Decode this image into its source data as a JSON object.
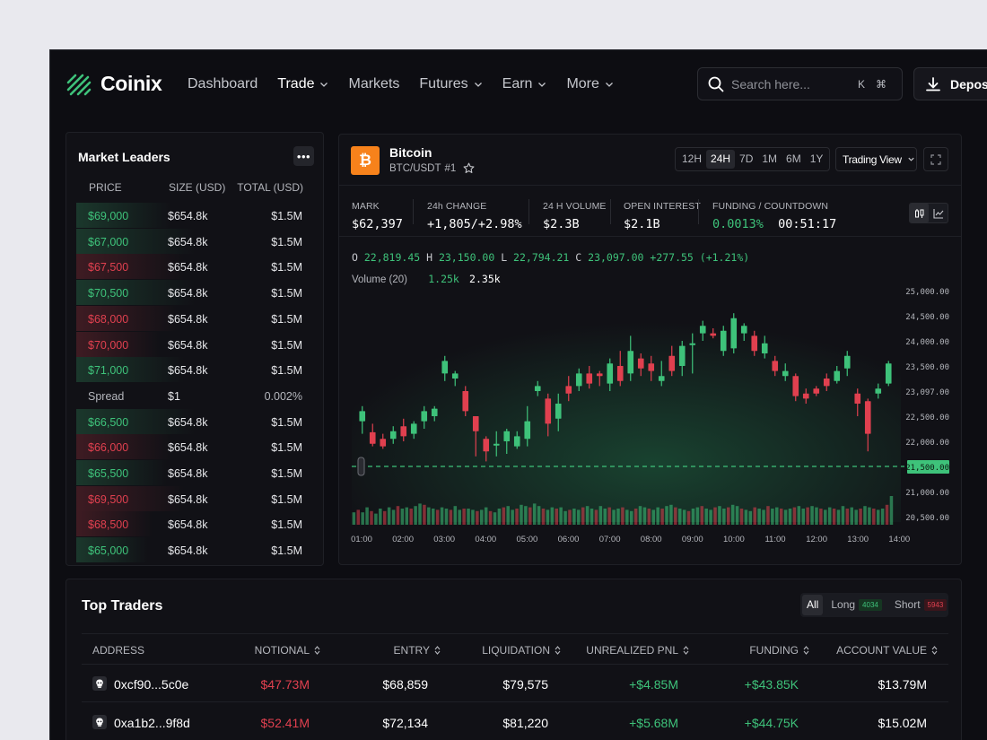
{
  "brand": {
    "name": "Coinix",
    "color": "#3ec27a"
  },
  "nav": [
    {
      "label": "Dashboard",
      "dropdown": false,
      "active": false
    },
    {
      "label": "Trade",
      "dropdown": true,
      "active": true
    },
    {
      "label": "Markets",
      "dropdown": false,
      "active": false
    },
    {
      "label": "Futures",
      "dropdown": true,
      "active": false
    },
    {
      "label": "Earn",
      "dropdown": true,
      "active": false
    },
    {
      "label": "More",
      "dropdown": true,
      "active": false
    }
  ],
  "search": {
    "placeholder": "Search here...",
    "shortcut_1": "K",
    "shortcut_2": "⌘"
  },
  "deposit_label": "Deposit",
  "leaders": {
    "title": "Market Leaders",
    "columns": [
      "PRICE",
      "SIZE (USD)",
      "TOTAL (USD)"
    ],
    "rows": [
      {
        "price": "$69,000",
        "size": "$654.8k",
        "total": "$1.5M",
        "side": "buy",
        "depth": 0.4
      },
      {
        "price": "$67,000",
        "size": "$654.8k",
        "total": "$1.5M",
        "side": "buy",
        "depth": 0.5
      },
      {
        "price": "$67,500",
        "size": "$654.8k",
        "total": "$1.5M",
        "side": "sell",
        "depth": 0.45
      },
      {
        "price": "$70,500",
        "size": "$654.8k",
        "total": "$1.5M",
        "side": "buy",
        "depth": 0.5
      },
      {
        "price": "$68,000",
        "size": "$654.8k",
        "total": "$1.5M",
        "side": "sell",
        "depth": 0.42
      },
      {
        "price": "$70,000",
        "size": "$654.8k",
        "total": "$1.5M",
        "side": "sell",
        "depth": 0.35
      },
      {
        "price": "$71,000",
        "size": "$654.8k",
        "total": "$1.5M",
        "side": "buy",
        "depth": 0.45
      },
      {
        "price": "Spread",
        "size": "$1",
        "total": "0.002%",
        "side": "spread",
        "depth": 0
      },
      {
        "price": "$66,500",
        "size": "$654.8k",
        "total": "$1.5M",
        "side": "buy",
        "depth": 0.5
      },
      {
        "price": "$66,000",
        "size": "$654.8k",
        "total": "$1.5M",
        "side": "sell",
        "depth": 0.4
      },
      {
        "price": "$65,500",
        "size": "$654.8k",
        "total": "$1.5M",
        "side": "buy",
        "depth": 0.38
      },
      {
        "price": "$69,500",
        "size": "$654.8k",
        "total": "$1.5M",
        "side": "sell",
        "depth": 0.45
      },
      {
        "price": "$68,500",
        "size": "$654.8k",
        "total": "$1.5M",
        "side": "sell",
        "depth": 0.32
      },
      {
        "price": "$65,000",
        "size": "$654.8k",
        "total": "$1.5M",
        "side": "buy",
        "depth": 0.3
      }
    ]
  },
  "coin": {
    "name": "Bitcoin",
    "pair": "BTC/USDT",
    "rank": "#1",
    "timeframes": [
      "12H",
      "24H",
      "7D",
      "1M",
      "6M",
      "1Y"
    ],
    "active_timeframe": "24H",
    "view_select": "Trading View"
  },
  "stats": [
    {
      "label": "MARK",
      "value": "$62,397",
      "color": "#ffffff"
    },
    {
      "label": "24h CHANGE",
      "value": "+1,805/+2.98%",
      "color": "#3ec27a"
    },
    {
      "label": "24 H VOLUME",
      "value": "$2.3B",
      "color": "#ffffff"
    },
    {
      "label": "OPEN INTEREST",
      "value": "$2.1B",
      "color": "#ffffff"
    },
    {
      "label": "FUNDING / COUNTDOWN",
      "value": "0.0013%",
      "value2": "00:51:17",
      "color": "#3ec27a"
    }
  ],
  "ohlc": {
    "o": "22,819.45",
    "h": "23,150.00",
    "l": "22,794.21",
    "c": "23,097.00",
    "chg": "+277.55 (+1.21%)"
  },
  "volume": {
    "label": "Volume (20)",
    "v1": "1.25k",
    "v2": "2.35k"
  },
  "chart_data": {
    "type": "candlestick",
    "x_ticks": [
      "01:00",
      "02:00",
      "03:00",
      "04:00",
      "05:00",
      "06:00",
      "07:00",
      "08:00",
      "09:00",
      "10:00",
      "11:00",
      "12:00",
      "13:00",
      "14:00"
    ],
    "y_ticks": [
      "25,000.00",
      "24,500.00",
      "24,000.00",
      "23,500.00",
      "23,097.00",
      "22,500.00",
      "22,000.00",
      "21,500.00",
      "21,000.00",
      "20,500.00"
    ],
    "current_price": "21,500.00",
    "colors": {
      "up": "#3ec27a",
      "down": "#e0404f"
    },
    "candles": [
      [
        22400,
        22600,
        22150,
        22700
      ],
      [
        22180,
        21950,
        21900,
        22350
      ],
      [
        22050,
        21900,
        21850,
        22150
      ],
      [
        22050,
        22200,
        21950,
        22300
      ],
      [
        22300,
        22100,
        22000,
        22450
      ],
      [
        22150,
        22350,
        22050,
        22400
      ],
      [
        22400,
        22600,
        22250,
        22700
      ],
      [
        22500,
        22650,
        22400,
        22700
      ],
      [
        23350,
        23600,
        23200,
        23700
      ],
      [
        23250,
        23350,
        23100,
        23400
      ],
      [
        23000,
        22600,
        22500,
        23100
      ],
      [
        22500,
        22200,
        21700,
        22500
      ],
      [
        22050,
        21800,
        21600,
        22100
      ],
      [
        21950,
        21950,
        21700,
        22200
      ],
      [
        22000,
        22200,
        21750,
        22250
      ],
      [
        21900,
        22100,
        21850,
        22200
      ],
      [
        22050,
        22400,
        21900,
        22700
      ],
      [
        23000,
        23100,
        22900,
        23200
      ],
      [
        22850,
        22350,
        22100,
        22950
      ],
      [
        22450,
        22750,
        22200,
        22950
      ],
      [
        23100,
        22950,
        22800,
        23300
      ],
      [
        23100,
        23350,
        23000,
        23450
      ],
      [
        23350,
        23150,
        23050,
        23500
      ],
      [
        23350,
        23300,
        23100,
        23400
      ],
      [
        23150,
        23550,
        23000,
        23650
      ],
      [
        23500,
        23200,
        23100,
        23800
      ],
      [
        23350,
        23800,
        23200,
        24100
      ],
      [
        23650,
        23450,
        23300,
        23750
      ],
      [
        23550,
        23400,
        23200,
        23700
      ],
      [
        23200,
        23300,
        23100,
        23600
      ],
      [
        23700,
        23400,
        23300,
        23900
      ],
      [
        23500,
        23900,
        23300,
        24000
      ],
      [
        23950,
        23950,
        23350,
        24150
      ],
      [
        24150,
        24300,
        24000,
        24400
      ],
      [
        24150,
        24100,
        24050,
        24250
      ],
      [
        23800,
        24200,
        23700,
        24300
      ],
      [
        23850,
        24450,
        23750,
        24550
      ],
      [
        24150,
        24300,
        24000,
        24350
      ],
      [
        24100,
        23800,
        23700,
        24200
      ],
      [
        23750,
        23950,
        23650,
        24100
      ],
      [
        23600,
        23400,
        23300,
        23700
      ],
      [
        23300,
        23400,
        23200,
        23550
      ],
      [
        23300,
        22900,
        22800,
        23350
      ],
      [
        22950,
        22850,
        22750,
        23050
      ],
      [
        23050,
        22950,
        22900,
        23100
      ],
      [
        23250,
        23100,
        23000,
        23350
      ],
      [
        23200,
        23400,
        23150,
        23500
      ],
      [
        23450,
        23700,
        23300,
        23800
      ],
      [
        22950,
        22750,
        22500,
        23050
      ],
      [
        22800,
        22150,
        21800,
        22850
      ],
      [
        22950,
        23050,
        22850,
        23150
      ],
      [
        23150,
        23550,
        23100,
        23600
      ]
    ],
    "volumes": [
      0.35,
      0.45,
      0.35,
      0.55,
      0.4,
      0.3,
      0.5,
      0.4,
      0.55,
      0.45,
      0.6,
      0.5,
      0.55,
      0.5,
      0.6,
      0.7,
      0.65,
      0.55,
      0.5,
      0.45,
      0.55,
      0.5,
      0.45,
      0.6,
      0.45,
      0.5,
      0.5,
      0.45,
      0.4,
      0.45,
      0.55,
      0.4,
      0.35,
      0.5,
      0.55,
      0.6,
      0.45,
      0.5,
      0.65,
      0.6,
      0.55,
      0.7,
      0.6,
      0.5,
      0.45,
      0.55,
      0.5,
      0.55,
      0.4,
      0.45,
      0.5,
      0.45,
      0.55,
      0.6,
      0.5,
      0.45,
      0.6,
      0.5,
      0.55,
      0.45,
      0.5,
      0.55,
      0.45,
      0.4,
      0.5,
      0.6,
      0.55,
      0.5,
      0.45,
      0.55,
      0.5,
      0.6,
      0.65,
      0.55,
      0.5,
      0.45,
      0.4,
      0.5,
      0.55,
      0.6,
      0.5,
      0.45,
      0.55,
      0.6,
      0.5,
      0.55,
      0.65,
      0.6,
      0.5,
      0.45,
      0.4,
      0.55,
      0.5,
      0.45,
      0.6,
      0.5,
      0.55,
      0.5,
      0.45,
      0.5,
      0.55,
      0.6,
      0.5,
      0.55,
      0.6,
      0.55,
      0.5,
      0.45,
      0.55,
      0.5,
      0.45,
      0.6,
      0.5,
      0.55,
      0.45,
      0.5,
      0.6,
      0.55,
      0.5,
      0.45,
      0.5,
      0.65,
      1.0
    ]
  },
  "traders": {
    "title": "Top Traders",
    "filters": [
      {
        "label": "All",
        "active": true
      },
      {
        "label": "Long",
        "count": "4034",
        "tone": "g"
      },
      {
        "label": "Short",
        "count": "5943",
        "tone": "r"
      }
    ],
    "columns": [
      "ADDRESS",
      "NOTIONAL",
      "ENTRY",
      "LIQUIDATION",
      "UNREALIZED PNL",
      "FUNDING",
      "ACCOUNT VALUE"
    ],
    "rows": [
      {
        "address": "0xcf90...5c0e",
        "notional": "$47.73M",
        "entry": "$68,859",
        "liquidation": "$79,575",
        "pnl": "+$4.85M",
        "funding": "+$43.85K",
        "account": "$13.79M"
      },
      {
        "address": "0xa1b2...9f8d",
        "notional": "$52.41M",
        "entry": "$72,134",
        "liquidation": "$81,220",
        "pnl": "+$5.68M",
        "funding": "+$44.75K",
        "account": "$15.02M"
      }
    ]
  }
}
